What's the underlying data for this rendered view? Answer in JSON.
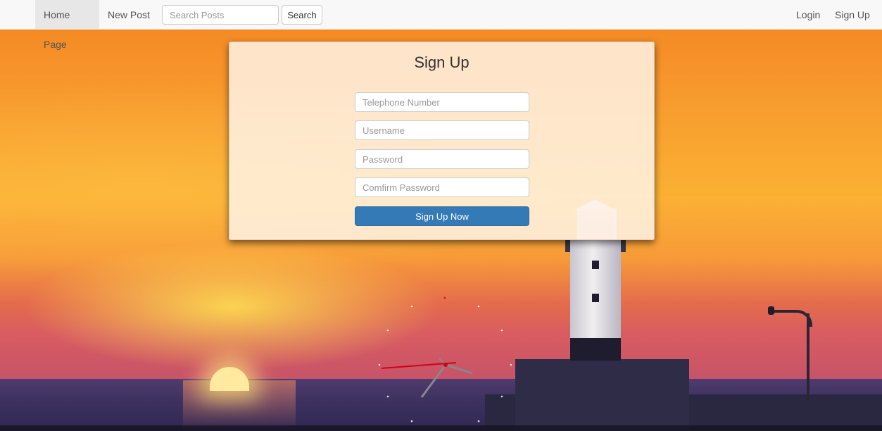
{
  "navbar": {
    "home_label": "Home Page",
    "new_post_label": "New Post",
    "search_placeholder": "Search Posts",
    "search_button_label": "Search",
    "login_label": "Login",
    "signup_label": "Sign Up"
  },
  "signup_form": {
    "title": "Sign Up",
    "telephone_placeholder": "Telephone Number",
    "username_placeholder": "Username",
    "password_placeholder": "Password",
    "confirm_password_placeholder": "Comfirm Password",
    "submit_label": "Sign Up Now"
  },
  "colors": {
    "primary_button": "#337ab7",
    "navbar_bg": "#f8f8f8",
    "active_nav_bg": "#e7e7e7",
    "clock_second_hand": "#d0021b"
  },
  "background": {
    "scene": "sunset-over-sea-with-lighthouse"
  }
}
